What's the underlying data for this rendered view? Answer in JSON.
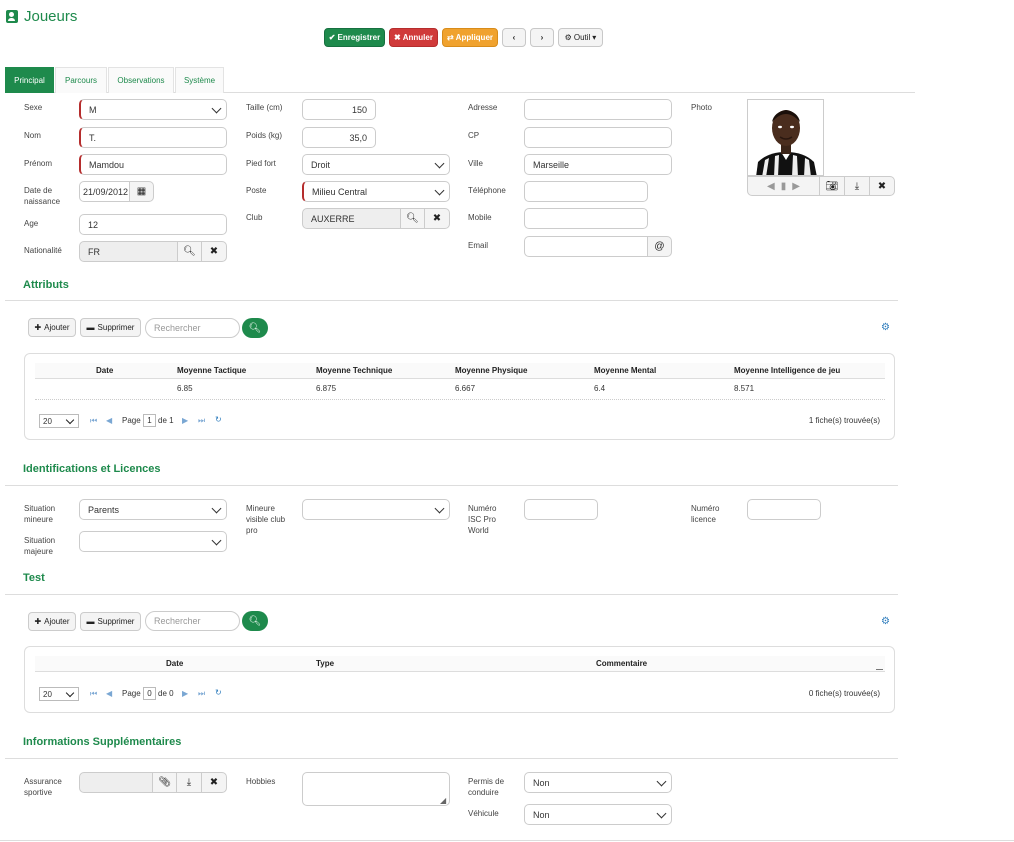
{
  "page_title": "Joueurs",
  "toolbar": {
    "save": "Enregistrer",
    "cancel": "Annuler",
    "apply": "Appliquer",
    "tools": "Outil"
  },
  "tabs": [
    "Principal",
    "Parcours",
    "Observations",
    "Système"
  ],
  "fields": {
    "sexe": {
      "label": "Sexe",
      "value": "M"
    },
    "nom": {
      "label": "Nom",
      "value": "T."
    },
    "prenom": {
      "label": "Prénom",
      "value": "Mamdou"
    },
    "naissance": {
      "label": "Date de naissance",
      "value": "21/09/2012"
    },
    "age": {
      "label": "Age",
      "value": "12"
    },
    "nationalite": {
      "label": "Nationalité",
      "value": "FR"
    },
    "taille": {
      "label": "Taille (cm)",
      "value": "150"
    },
    "poids": {
      "label": "Poids (kg)",
      "value": "35,0"
    },
    "pied": {
      "label": "Pied fort",
      "value": "Droit"
    },
    "poste": {
      "label": "Poste",
      "value": "Milieu Central"
    },
    "club": {
      "label": "Club",
      "value": "AUXERRE"
    },
    "adresse": {
      "label": "Adresse",
      "value": ""
    },
    "cp": {
      "label": "CP",
      "value": ""
    },
    "ville": {
      "label": "Ville",
      "value": "Marseille"
    },
    "telephone": {
      "label": "Téléphone",
      "value": ""
    },
    "mobile": {
      "label": "Mobile",
      "value": ""
    },
    "email": {
      "label": "Email",
      "value": ""
    },
    "photo": {
      "label": "Photo"
    }
  },
  "attributs": {
    "title": "Attributs",
    "add": "Ajouter",
    "delete": "Supprimer",
    "search_placeholder": "Rechercher",
    "columns": [
      "Date",
      "Moyenne Tactique",
      "Moyenne Technique",
      "Moyenne Physique",
      "Moyenne Mental",
      "Moyenne Intelligence de jeu"
    ],
    "rows": [
      [
        "",
        "6.85",
        "6.875",
        "6.667",
        "6.4",
        "8.571"
      ]
    ],
    "page_size": "20",
    "page_label": "Page",
    "page": "1",
    "of_label": "de 1",
    "count": "1 fiche(s) trouvée(s)"
  },
  "identifications": {
    "title": "Identifications et Licences",
    "situation_mineure": {
      "label": "Situation mineure",
      "value": "Parents"
    },
    "situation_majeure": {
      "label": "Situation majeure",
      "value": ""
    },
    "mineure_visible": {
      "label": "Mineure visible club pro",
      "value": ""
    },
    "numero_isc": {
      "label": "Numéro ISC Pro World",
      "value": ""
    },
    "numero_licence": {
      "label": "Numéro licence",
      "value": ""
    }
  },
  "test": {
    "title": "Test",
    "add": "Ajouter",
    "delete": "Supprimer",
    "search_placeholder": "Rechercher",
    "columns": [
      "Date",
      "Type",
      "Commentaire"
    ],
    "page_size": "20",
    "page_label": "Page",
    "page": "0",
    "of_label": "de 0",
    "count": "0 fiche(s) trouvée(s)"
  },
  "infos": {
    "title": "Informations Supplémentaires",
    "assurance": {
      "label": "Assurance sportive",
      "value": ""
    },
    "hobbies": {
      "label": "Hobbies",
      "value": ""
    },
    "permis": {
      "label": "Permis de conduire",
      "value": "Non"
    },
    "vehicule": {
      "label": "Véhicule",
      "value": "Non"
    }
  },
  "colors": {
    "accent": "#1e8a4c",
    "danger": "#d03a3a",
    "warning": "#f0a22e",
    "link": "#2f7dbd"
  }
}
